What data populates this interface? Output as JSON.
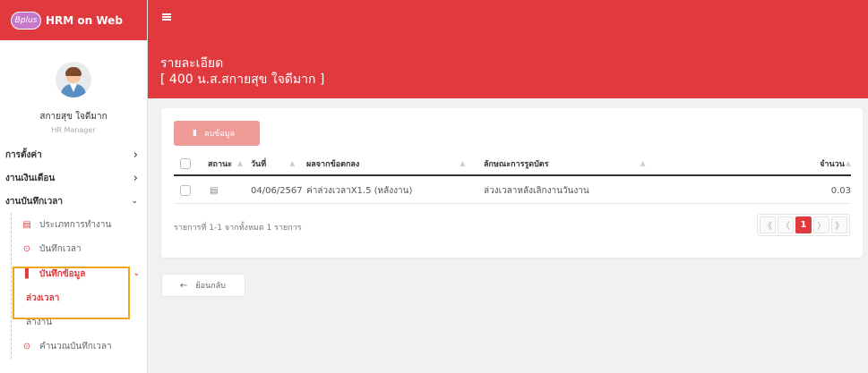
{
  "app": {
    "logo_text": "Bplus",
    "name": "HRM on Web"
  },
  "profile": {
    "name": "สกายสุข ใจดีมาก",
    "role": "HR Manager"
  },
  "menu": {
    "settings": "การตั้งค่า",
    "payroll": "งานเงินเดือน",
    "timekeeping": "งานบันทึกเวลา",
    "sub": {
      "work_type": "ประเภทการทำงาน",
      "time_record": "บันทึกเวลา",
      "data_record": "บันทึกข้อมูล",
      "overtime": "ล่วงเวลา",
      "leave": "ลางาน",
      "calc_time": "คำนวณบันทึกเวลา"
    }
  },
  "header": {
    "title": "รายละเอียด",
    "subtitle": "[ 400 น.ส.สกายสุข ใจดีมาก ]"
  },
  "toolbar": {
    "delete_label": "ลบข้อมูล"
  },
  "table": {
    "headers": {
      "status": "สถานะ",
      "date": "วันที่",
      "result": "ผลจากข้อตกลง",
      "nature": "ลักษณะการรูดบัตร",
      "qty": "จำนวน"
    },
    "rows": [
      {
        "date": "04/06/2567",
        "result": "ค่าล่วงเวลาX1.5 (หลังงาน)",
        "nature": "ล่วงเวลาหลังเลิกงานวันงาน",
        "qty": "0.03"
      }
    ]
  },
  "footer": {
    "info": "รายการที่ 1-1 จากทั้งหมด 1 รายการ"
  },
  "pagination": {
    "first": "《",
    "prev": "〈",
    "current": "1",
    "next": "〉",
    "last": "》"
  },
  "back": {
    "label": "ย้อนกลับ"
  }
}
